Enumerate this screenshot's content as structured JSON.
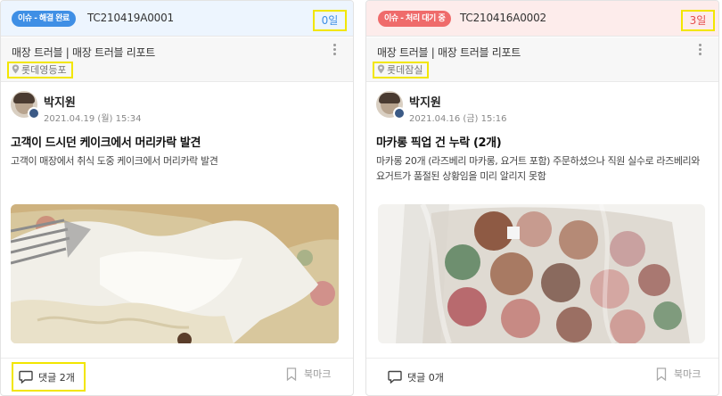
{
  "cards": [
    {
      "status": "이슈 - 해결 완료",
      "code": "TC210419A0001",
      "days": "0일",
      "category": "매장 트러블 | 매장 트러블 리포트",
      "store": "롯데영등포",
      "author": "박지원",
      "date": "2021.04.19 (월) 15:34",
      "title": "고객이 드시던 케이크에서 머리카락 발견",
      "body": "고객이 매장에서 취식 도중 케이크에서 머리카락 발견",
      "comments": "댓글 2개",
      "bookmark": "북마크"
    },
    {
      "status": "이슈 - 처리 대기 중",
      "code": "TC210416A0002",
      "days": "3일",
      "category": "매장 트러블 | 매장 트러블 리포트",
      "store": "롯데잠실",
      "author": "박지원",
      "date": "2021.04.16 (금) 15:16",
      "title": "마카롱 픽업 건 누락 (2개)",
      "body": "마카롱 20개 (라즈베리 마카롱, 요거트 포함) 주문하셨으나 직원 실수로 라즈베리와 요거트가 품절된 상황임을 미리 알리지 못함",
      "comments": "댓글 0개",
      "bookmark": "북마크"
    }
  ],
  "colors": {
    "resolved": "#3f8fe5",
    "pending": "#ef6b6b",
    "highlight": "#f2e600"
  },
  "icons": [
    "location-pin-icon",
    "more-vertical-icon",
    "comment-icon",
    "bookmark-icon",
    "profile-badge-icon"
  ]
}
